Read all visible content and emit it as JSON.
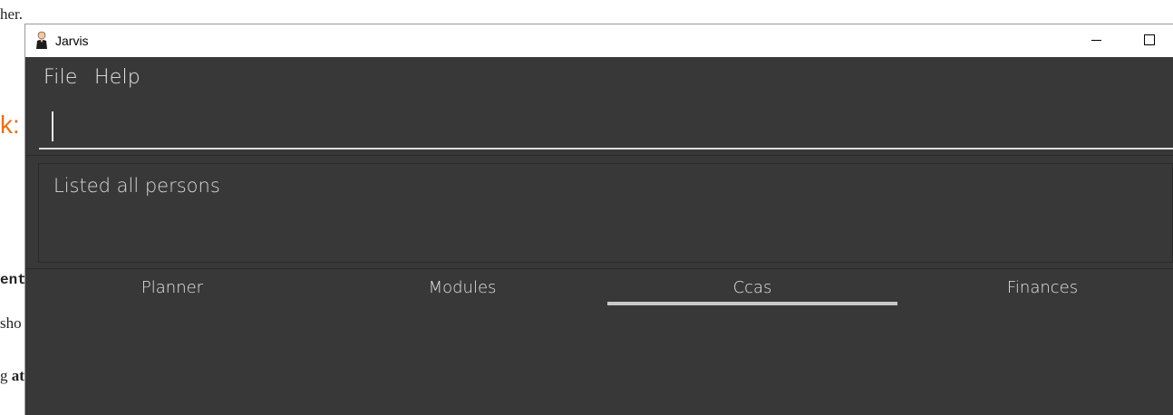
{
  "background_page": {
    "frag1": "her.",
    "frag2": "k:",
    "frag3": "ent",
    "frag4": "sho",
    "frag5_normal": "g ",
    "frag5_bold": "at"
  },
  "window": {
    "title": "Jarvis",
    "icon": "butler-icon"
  },
  "menu": {
    "items": [
      "File",
      "Help"
    ]
  },
  "command_box": {
    "value": ""
  },
  "result_display": {
    "text": "Listed all persons"
  },
  "tabs": {
    "items": [
      "Planner",
      "Modules",
      "Ccas",
      "Finances"
    ],
    "selected": "Ccas"
  }
}
